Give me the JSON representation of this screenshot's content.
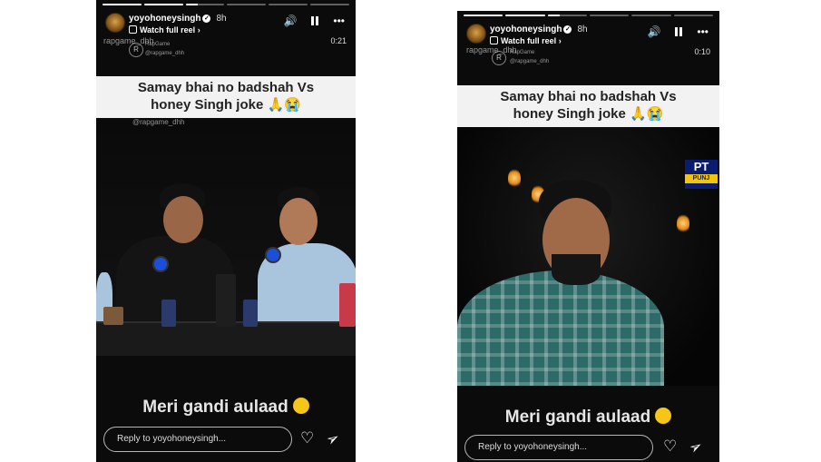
{
  "stories": [
    {
      "username": "yoyohoneysingh",
      "time": "8h",
      "watch_label": "Watch full reel",
      "duration": "0:21",
      "watermark_top": "rapgame_dhh",
      "watermark_brand": "RapGame",
      "watermark_handle": "@rapgame_dhh",
      "watermark_mid": "@rapgame_dhh",
      "caption_line1": "Samay bhai no badshah Vs",
      "caption_line2": "honey Singh joke",
      "bottom_caption": "Meri gandi aulaad",
      "reply_placeholder": "Reply to yoyohoneysingh..."
    },
    {
      "username": "yoyohoneysingh",
      "time": "8h",
      "watch_label": "Watch full reel",
      "duration": "0:10",
      "watermark_top": "rapgame_dhh",
      "watermark_brand": "RapGame",
      "watermark_handle": "@rapgame_dhh",
      "watermark_mid": "rapgame_dhh",
      "channel_logo": "PT",
      "channel_sub": "PUNJ",
      "caption_line1": "Samay bhai no badshah Vs",
      "caption_line2": "honey Singh joke",
      "bottom_caption": "Meri gandi aulaad",
      "reply_placeholder": "Reply to yoyohoneysingh..."
    }
  ],
  "icons": {
    "verified": "✓",
    "chevron": "›",
    "speaker": "🔊",
    "more": "•••",
    "heart": "♡",
    "send": "➢",
    "pray": "🙏",
    "cry": "😭"
  }
}
